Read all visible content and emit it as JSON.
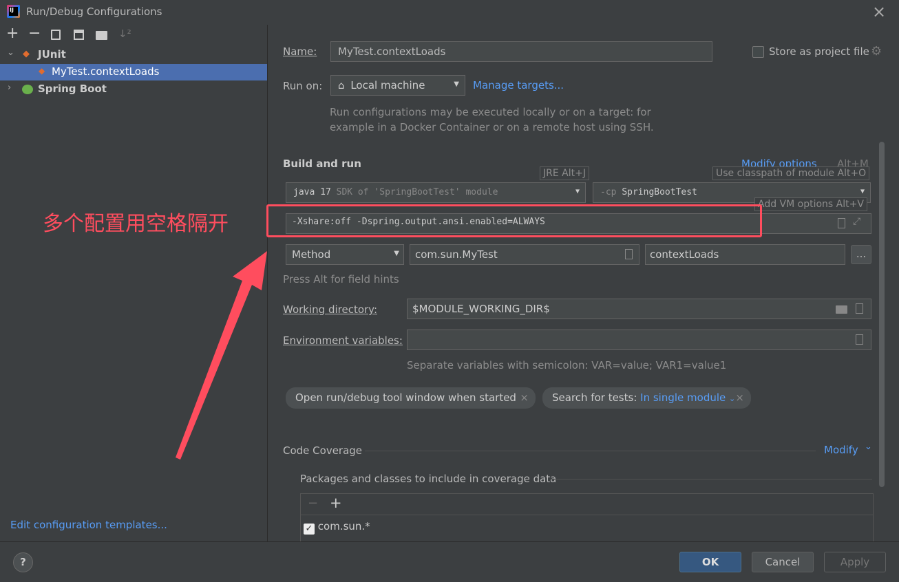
{
  "window": {
    "title": "Run/Debug Configurations",
    "app_icon": "intellij-icon",
    "close": "×"
  },
  "toolbar": {
    "add": "+",
    "remove": "−",
    "copy": "⧉",
    "save": "💾",
    "folder": "📁",
    "sort": "↓ª"
  },
  "tree": {
    "junit_label": "JUnit",
    "test_label": "MyTest.contextLoads",
    "springboot_label": "Spring Boot"
  },
  "edit_templates": "Edit configuration templates...",
  "form": {
    "name_label": "Name:",
    "name_value": "MyTest.contextLoads",
    "store_label": "Store as project file",
    "runon_label": "Run on:",
    "runon_value": "Local machine",
    "manage_targets": "Manage targets...",
    "runon_help_1": "Run configurations may be executed locally or on a target: for",
    "runon_help_2": "example in a Docker Container or on a remote host using SSH.",
    "build_run": "Build and run",
    "modify_options": "Modify options",
    "modify_shortcut": "Alt+M",
    "jre_hint": "JRE Alt+J",
    "classpath_hint": "Use classpath of module Alt+O",
    "vm_hint": "Add VM options Alt+V",
    "jre_java": "java 17",
    "jre_rest": "SDK of 'SpringBootTest' module",
    "cp_prefix": "-cp",
    "cp_value": "SpringBootTest",
    "vm_options": "-Xshare:off -Dspring.output.ansi.enabled=ALWAYS",
    "method_value": "Method",
    "class_value": "com.sun.MyTest",
    "method_name": "contextLoads",
    "dots": "...",
    "field_hints": "Press Alt for field hints",
    "workdir_label": "Working directory:",
    "workdir_value": "$MODULE_WORKING_DIR$",
    "env_label": "Environment variables:",
    "env_value": "",
    "env_help": "Separate variables with semicolon: VAR=value; VAR1=value1",
    "tag1": "Open run/debug tool window when started",
    "tag2_label": "Search for tests:",
    "tag2_value": "In single module",
    "coverage_title": "Code Coverage",
    "coverage_modify": "Modify",
    "packages_label": "Packages and classes to include in coverage data",
    "pkg_minus": "−",
    "pkg_plus": "+",
    "pkg_item": "com.sun.*"
  },
  "annotation": {
    "text": "多个配置用空格隔开",
    "color": "#ff4d5e"
  },
  "buttons": {
    "help": "?",
    "ok": "OK",
    "cancel": "Cancel",
    "apply": "Apply"
  },
  "colors": {
    "accent": "#589df6",
    "ok_bg": "#365880",
    "selection": "#4b6eaf",
    "annotation": "#ff4d5e"
  }
}
